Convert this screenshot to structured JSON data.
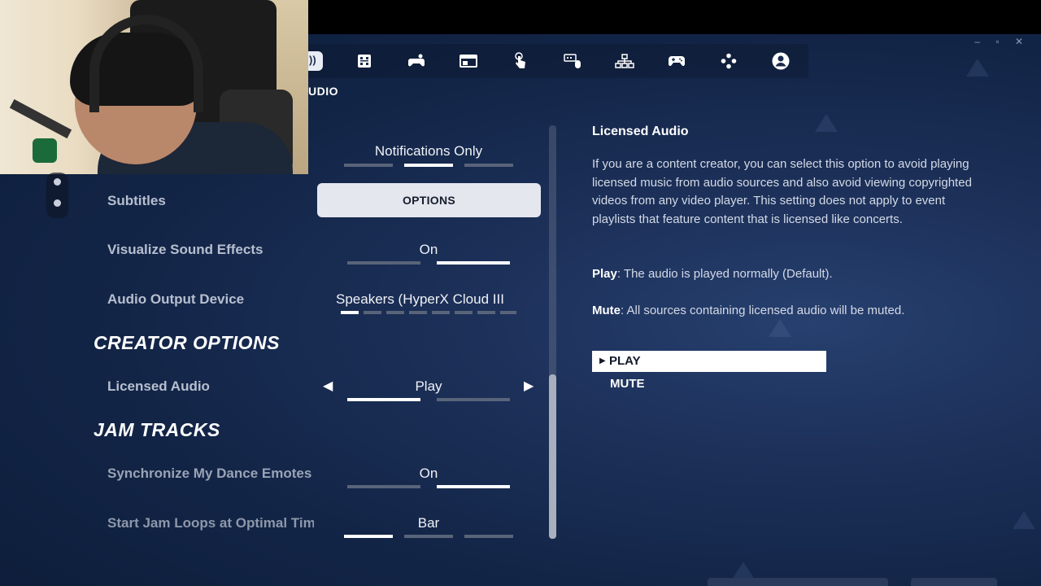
{
  "tabs": {
    "active_glyph": "))",
    "section_label": "UDIO",
    "icons": [
      "grid-icon",
      "gamepad-settings-icon",
      "display-icon",
      "touch-icon",
      "keyboard-mouse-icon",
      "network-icon",
      "controller-icon",
      "controller-buttons-icon",
      "account-icon"
    ]
  },
  "settings": {
    "notifications": {
      "value": "Notifications Only"
    },
    "subtitles": {
      "label": "Subtitles",
      "button": "OPTIONS"
    },
    "visualize_sfx": {
      "label": "Visualize Sound Effects",
      "value": "On"
    },
    "audio_output": {
      "label": "Audio Output Device",
      "value": "Speakers (HyperX Cloud III"
    },
    "creator_section": "CREATOR OPTIONS",
    "licensed_audio": {
      "label": "Licensed Audio",
      "value": "Play"
    },
    "jam_section": "JAM TRACKS",
    "sync_emotes": {
      "label": "Synchronize My Dance Emotes",
      "value": "On"
    },
    "jam_loops": {
      "label": "Start Jam Loops at Optimal Time",
      "value": "Bar"
    }
  },
  "details": {
    "title": "Licensed Audio",
    "body": "If you are a content creator, you can select this option to avoid playing licensed music from audio sources and also avoid viewing copyrighted videos from any video player. This setting does not apply to event playlists that feature content that is licensed like concerts.",
    "play_term": "Play",
    "play_desc": ": The audio is played normally (Default).",
    "mute_term": "Mute",
    "mute_desc": ": All sources containing licensed audio will be muted.",
    "options": [
      "PLAY",
      "MUTE"
    ]
  },
  "colors": {
    "accent": "#ffffff",
    "background": "#132547"
  }
}
